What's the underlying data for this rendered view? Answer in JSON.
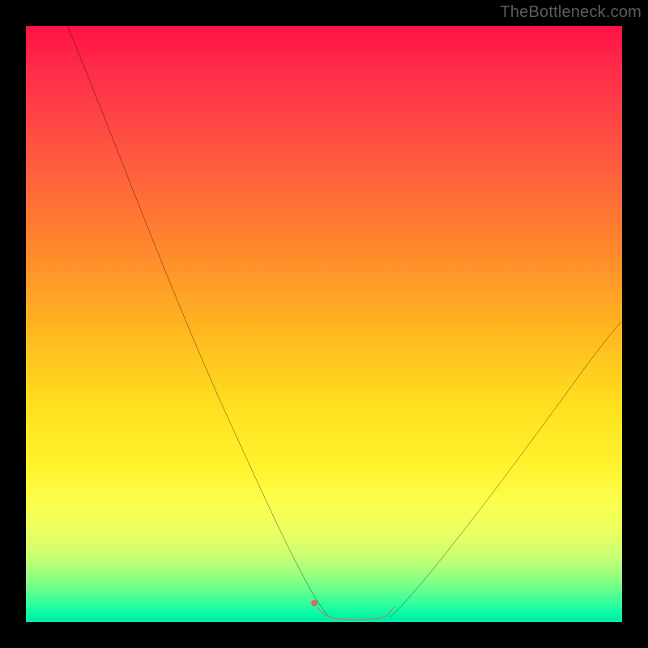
{
  "watermark": "TheBottleneck.com",
  "chart_data": {
    "type": "line",
    "title": "",
    "xlabel": "",
    "ylabel": "",
    "xlim": [
      0,
      100
    ],
    "ylim": [
      0,
      100
    ],
    "grid": false,
    "legend": false,
    "background_gradient": {
      "direction": "vertical",
      "stops": [
        {
          "pos": 0.0,
          "color": "#ff1345"
        },
        {
          "pos": 0.5,
          "color": "#ffba1f"
        },
        {
          "pos": 0.8,
          "color": "#faff4d"
        },
        {
          "pos": 1.0,
          "color": "#00e8a8"
        }
      ]
    },
    "series": [
      {
        "name": "bottleneck-curve-left",
        "stroke": "#000000",
        "x": [
          7,
          12,
          18,
          24,
          30,
          36,
          42,
          46,
          49,
          51
        ],
        "y": [
          100,
          86,
          71,
          57,
          43,
          29,
          16,
          8,
          3,
          1
        ]
      },
      {
        "name": "bottleneck-curve-right",
        "stroke": "#000000",
        "x": [
          61,
          64,
          68,
          74,
          80,
          86,
          92,
          97,
          100
        ],
        "y": [
          1,
          3,
          7,
          14,
          22,
          30,
          38,
          45,
          50
        ]
      },
      {
        "name": "flat-bottom-highlight",
        "stroke": "#d86a62",
        "x": [
          49,
          51,
          53,
          55,
          57,
          59,
          61
        ],
        "y": [
          2,
          0.8,
          0.5,
          0.5,
          0.5,
          0.8,
          2
        ]
      }
    ],
    "markers": [
      {
        "name": "left-peak-dot",
        "x": 48.5,
        "y": 3,
        "color": "#d86a62",
        "r": 3
      }
    ]
  }
}
